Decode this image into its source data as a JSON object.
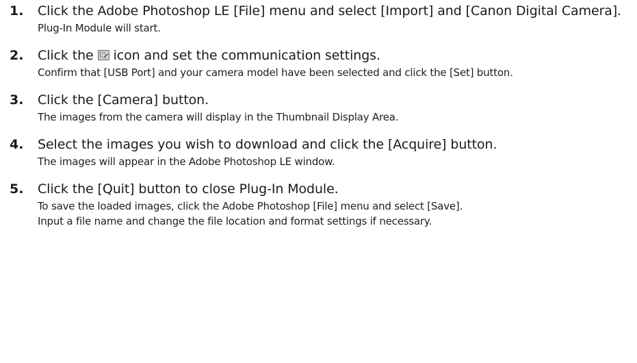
{
  "steps": [
    {
      "number": "1.",
      "heading": "Click the Adobe Photoshop LE [File] menu and select [Import] and [Canon Digital Camera].",
      "body": [
        "Plug-In Module will start."
      ]
    },
    {
      "number": "2.",
      "heading_before_icon": "Click the",
      "icon": "settings-dialog-icon",
      "heading_after_icon": "icon and set the communication settings.",
      "body": [
        "Confirm that [USB Port] and your camera model have been selected and click the [Set] button."
      ]
    },
    {
      "number": "3.",
      "heading": "Click the [Camera] button.",
      "body": [
        "The images from the camera will display in the Thumbnail Display Area."
      ]
    },
    {
      "number": "4.",
      "heading": "Select the images you wish to download and click the [Acquire] button.",
      "body": [
        "The images will appear in the Adobe Photoshop LE window."
      ]
    },
    {
      "number": "5.",
      "heading": "Click the [Quit] button to close Plug-In Module.",
      "body": [
        "To save the loaded images, click the Adobe Photoshop [File] menu and select [Save].",
        "Input a file name and change the file location and format settings if necessary."
      ]
    }
  ]
}
